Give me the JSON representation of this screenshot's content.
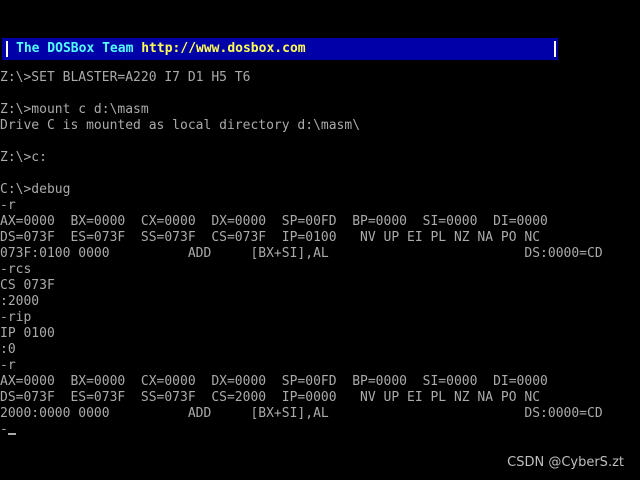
{
  "banner": {
    "team": "The DOSBox Team",
    "url": "http://www.dosbox.com"
  },
  "console_lines": [
    "Z:\\>SET BLASTER=A220 I7 D1 H5 T6",
    "",
    "Z:\\>mount c d:\\masm",
    "Drive C is mounted as local directory d:\\masm\\",
    "",
    "Z:\\>c:",
    "",
    "C:\\>debug",
    "-r",
    "AX=0000  BX=0000  CX=0000  DX=0000  SP=00FD  BP=0000  SI=0000  DI=0000",
    "DS=073F  ES=073F  SS=073F  CS=073F  IP=0100   NV UP EI PL NZ NA PO NC",
    "073F:0100 0000          ADD     [BX+SI],AL                         DS:0000=CD",
    "-rcs",
    "CS 073F",
    ":2000",
    "-rip",
    "IP 0100",
    ":0",
    "-r",
    "AX=0000  BX=0000  CX=0000  DX=0000  SP=00FD  BP=0000  SI=0000  DI=0000",
    "DS=073F  ES=073F  SS=073F  CS=2000  IP=0000   NV UP EI PL NZ NA PO NC",
    "2000:0000 0000          ADD     [BX+SI],AL                         DS:0000=CD",
    "-"
  ],
  "watermark": "CSDN @CyberS.zt",
  "colors": {
    "background": "#000000",
    "text": "#aaaaaa",
    "banner_bg": "#0000a8",
    "banner_team": "#55ffff",
    "banner_url": "#ffff55"
  }
}
